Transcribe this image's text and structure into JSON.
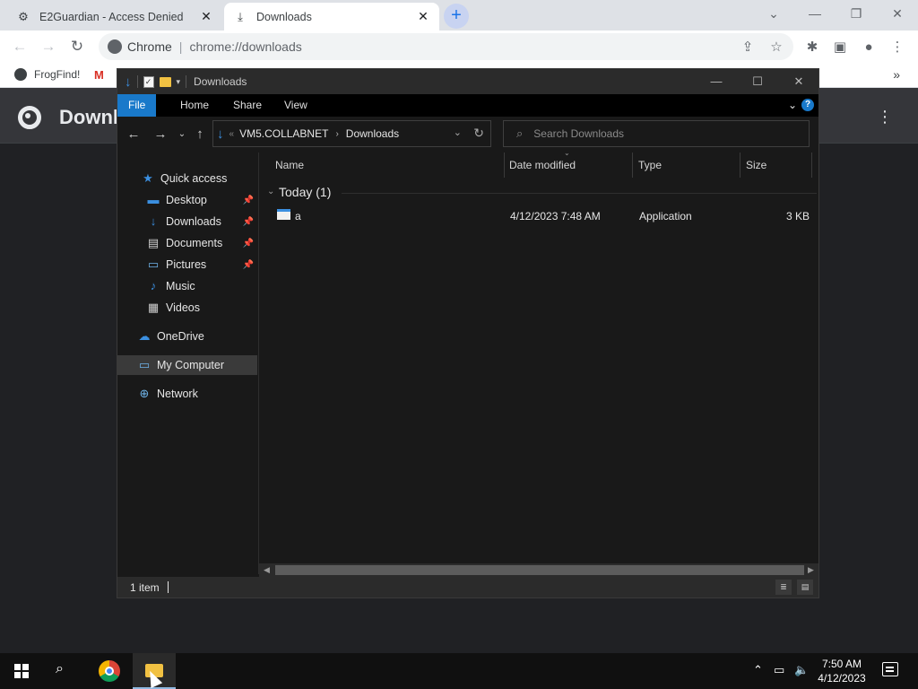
{
  "browser": {
    "tabs": [
      {
        "title": "E2Guardian - Access Denied",
        "icon": "e2guardian-icon"
      },
      {
        "title": "Downloads",
        "icon": "download-icon"
      }
    ],
    "omnibox": {
      "scheme": "Chrome",
      "url": "chrome://downloads"
    },
    "bookmarks": [
      {
        "label": "FrogFind!"
      }
    ],
    "page_title": "Downloads"
  },
  "explorer": {
    "title": "Downloads",
    "ribbon_tabs": [
      "File",
      "Home",
      "Share",
      "View"
    ],
    "address": {
      "root": "VM5.COLLABNET",
      "current": "Downloads"
    },
    "search_placeholder": "Search Downloads",
    "nav": {
      "quick_access": "Quick access",
      "items": [
        "Desktop",
        "Downloads",
        "Documents",
        "Pictures",
        "Music",
        "Videos"
      ],
      "onedrive": "OneDrive",
      "my_computer": "My Computer",
      "network": "Network"
    },
    "columns": [
      "Name",
      "Date modified",
      "Type",
      "Size"
    ],
    "group": "Today (1)",
    "files": [
      {
        "name": "a",
        "date": "4/12/2023 7:48 AM",
        "type": "Application",
        "size": "3 KB"
      }
    ],
    "status": "1 item"
  },
  "taskbar": {
    "time": "7:50 AM",
    "date": "4/12/2023"
  },
  "colors": {
    "ribbon_file": "#1979ca",
    "chrome_newtab": "#c8d3f1",
    "folder": "#f1c142"
  }
}
